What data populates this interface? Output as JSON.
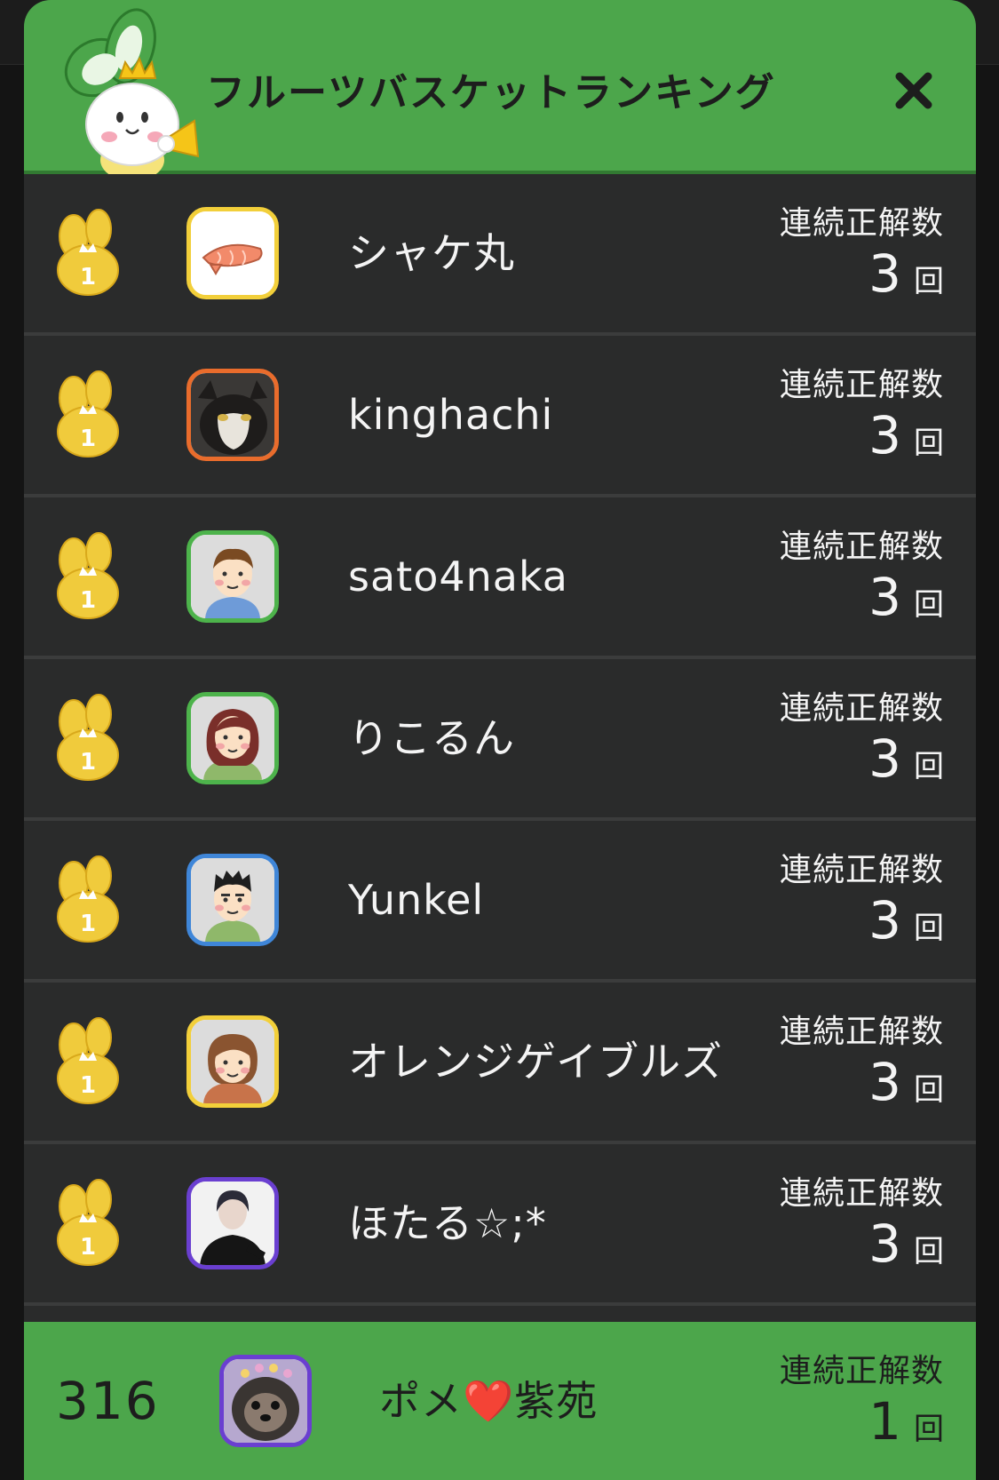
{
  "header": {
    "title": "フルーツバスケットランキング",
    "close_label": "×"
  },
  "ranking": {
    "entries": [
      {
        "rank": "1",
        "name": "シャケ丸",
        "streak_label": "連続正解数",
        "streak_count": "3",
        "streak_unit": "回",
        "avatar": "salmon-avatar",
        "frame_color": "#f2cf3a"
      },
      {
        "rank": "1",
        "name": "kinghachi",
        "streak_label": "連続正解数",
        "streak_count": "3",
        "streak_unit": "回",
        "avatar": "cat-photo-avatar",
        "frame_color": "#e96c2c"
      },
      {
        "rank": "1",
        "name": "sato4naka",
        "streak_label": "連続正解数",
        "streak_count": "3",
        "streak_unit": "回",
        "avatar": "man-avatar",
        "frame_color": "#4db34b"
      },
      {
        "rank": "1",
        "name": "りこるん",
        "streak_label": "連続正解数",
        "streak_count": "3",
        "streak_unit": "回",
        "avatar": "woman-avatar",
        "frame_color": "#4db34b"
      },
      {
        "rank": "1",
        "name": "Yunkel",
        "streak_label": "連続正解数",
        "streak_count": "3",
        "streak_unit": "回",
        "avatar": "man-avatar",
        "frame_color": "#3f86d8"
      },
      {
        "rank": "1",
        "name": "オレンジゲイブルズ",
        "streak_label": "連続正解数",
        "streak_count": "3",
        "streak_unit": "回",
        "avatar": "woman-avatar",
        "frame_color": "#f2cf3a"
      },
      {
        "rank": "1",
        "name": "ほたる☆;*",
        "streak_label": "連続正解数",
        "streak_count": "3",
        "streak_unit": "回",
        "avatar": "person-photo-avatar",
        "frame_color": "#6a3fd0"
      }
    ]
  },
  "my_entry": {
    "rank": "316",
    "name": "ポメ❤️紫苑",
    "streak_label": "連続正解数",
    "streak_count": "1",
    "streak_unit": "回",
    "avatar": "dog-photo-avatar",
    "frame_color": "#6a3fd0"
  },
  "colors": {
    "header_green": "#4ca64b",
    "row_background": "#2a2b2b",
    "medal_gold": "#f0cb3c"
  }
}
